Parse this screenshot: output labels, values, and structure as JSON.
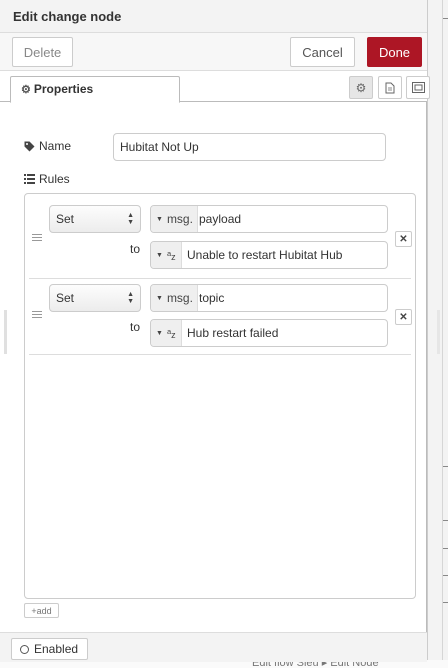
{
  "tray": {
    "title": "Edit change node",
    "delete_label": "Delete",
    "cancel_label": "Cancel",
    "done_label": "Done",
    "done_color": "#ad1625"
  },
  "tabs": {
    "properties_label": "Properties",
    "icons": [
      "gear-icon",
      "description-icon",
      "appearance-icon"
    ]
  },
  "form": {
    "name_label": "Name",
    "name_value": "Hubitat Not Up",
    "rules_label": "Rules",
    "to_label": "to",
    "add_label": "add"
  },
  "rules": [
    {
      "action": "Set",
      "target_type": "msg.",
      "target": "payload",
      "value_type": "az",
      "value": "Unable to restart Hubitat Hub"
    },
    {
      "action": "Set",
      "target_type": "msg.",
      "target": "topic",
      "value_type": "az",
      "value": "Hub restart failed"
    }
  ],
  "footer": {
    "enabled_label": "Enabled"
  },
  "background": {
    "partial_text": "Edit flow  Sieu ▸ Edit Node"
  }
}
